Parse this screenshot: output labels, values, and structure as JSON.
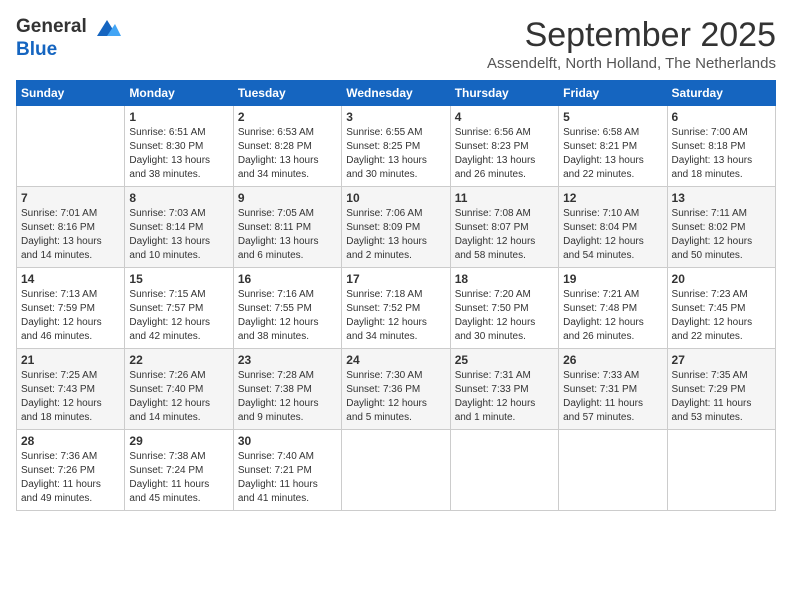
{
  "header": {
    "logo_line1": "General",
    "logo_line2": "Blue",
    "month": "September 2025",
    "location": "Assendelft, North Holland, The Netherlands"
  },
  "days_of_week": [
    "Sunday",
    "Monday",
    "Tuesday",
    "Wednesday",
    "Thursday",
    "Friday",
    "Saturday"
  ],
  "weeks": [
    [
      {
        "day": "",
        "info": ""
      },
      {
        "day": "1",
        "info": "Sunrise: 6:51 AM\nSunset: 8:30 PM\nDaylight: 13 hours\nand 38 minutes."
      },
      {
        "day": "2",
        "info": "Sunrise: 6:53 AM\nSunset: 8:28 PM\nDaylight: 13 hours\nand 34 minutes."
      },
      {
        "day": "3",
        "info": "Sunrise: 6:55 AM\nSunset: 8:25 PM\nDaylight: 13 hours\nand 30 minutes."
      },
      {
        "day": "4",
        "info": "Sunrise: 6:56 AM\nSunset: 8:23 PM\nDaylight: 13 hours\nand 26 minutes."
      },
      {
        "day": "5",
        "info": "Sunrise: 6:58 AM\nSunset: 8:21 PM\nDaylight: 13 hours\nand 22 minutes."
      },
      {
        "day": "6",
        "info": "Sunrise: 7:00 AM\nSunset: 8:18 PM\nDaylight: 13 hours\nand 18 minutes."
      }
    ],
    [
      {
        "day": "7",
        "info": "Sunrise: 7:01 AM\nSunset: 8:16 PM\nDaylight: 13 hours\nand 14 minutes."
      },
      {
        "day": "8",
        "info": "Sunrise: 7:03 AM\nSunset: 8:14 PM\nDaylight: 13 hours\nand 10 minutes."
      },
      {
        "day": "9",
        "info": "Sunrise: 7:05 AM\nSunset: 8:11 PM\nDaylight: 13 hours\nand 6 minutes."
      },
      {
        "day": "10",
        "info": "Sunrise: 7:06 AM\nSunset: 8:09 PM\nDaylight: 13 hours\nand 2 minutes."
      },
      {
        "day": "11",
        "info": "Sunrise: 7:08 AM\nSunset: 8:07 PM\nDaylight: 12 hours\nand 58 minutes."
      },
      {
        "day": "12",
        "info": "Sunrise: 7:10 AM\nSunset: 8:04 PM\nDaylight: 12 hours\nand 54 minutes."
      },
      {
        "day": "13",
        "info": "Sunrise: 7:11 AM\nSunset: 8:02 PM\nDaylight: 12 hours\nand 50 minutes."
      }
    ],
    [
      {
        "day": "14",
        "info": "Sunrise: 7:13 AM\nSunset: 7:59 PM\nDaylight: 12 hours\nand 46 minutes."
      },
      {
        "day": "15",
        "info": "Sunrise: 7:15 AM\nSunset: 7:57 PM\nDaylight: 12 hours\nand 42 minutes."
      },
      {
        "day": "16",
        "info": "Sunrise: 7:16 AM\nSunset: 7:55 PM\nDaylight: 12 hours\nand 38 minutes."
      },
      {
        "day": "17",
        "info": "Sunrise: 7:18 AM\nSunset: 7:52 PM\nDaylight: 12 hours\nand 34 minutes."
      },
      {
        "day": "18",
        "info": "Sunrise: 7:20 AM\nSunset: 7:50 PM\nDaylight: 12 hours\nand 30 minutes."
      },
      {
        "day": "19",
        "info": "Sunrise: 7:21 AM\nSunset: 7:48 PM\nDaylight: 12 hours\nand 26 minutes."
      },
      {
        "day": "20",
        "info": "Sunrise: 7:23 AM\nSunset: 7:45 PM\nDaylight: 12 hours\nand 22 minutes."
      }
    ],
    [
      {
        "day": "21",
        "info": "Sunrise: 7:25 AM\nSunset: 7:43 PM\nDaylight: 12 hours\nand 18 minutes."
      },
      {
        "day": "22",
        "info": "Sunrise: 7:26 AM\nSunset: 7:40 PM\nDaylight: 12 hours\nand 14 minutes."
      },
      {
        "day": "23",
        "info": "Sunrise: 7:28 AM\nSunset: 7:38 PM\nDaylight: 12 hours\nand 9 minutes."
      },
      {
        "day": "24",
        "info": "Sunrise: 7:30 AM\nSunset: 7:36 PM\nDaylight: 12 hours\nand 5 minutes."
      },
      {
        "day": "25",
        "info": "Sunrise: 7:31 AM\nSunset: 7:33 PM\nDaylight: 12 hours\nand 1 minute."
      },
      {
        "day": "26",
        "info": "Sunrise: 7:33 AM\nSunset: 7:31 PM\nDaylight: 11 hours\nand 57 minutes."
      },
      {
        "day": "27",
        "info": "Sunrise: 7:35 AM\nSunset: 7:29 PM\nDaylight: 11 hours\nand 53 minutes."
      }
    ],
    [
      {
        "day": "28",
        "info": "Sunrise: 7:36 AM\nSunset: 7:26 PM\nDaylight: 11 hours\nand 49 minutes."
      },
      {
        "day": "29",
        "info": "Sunrise: 7:38 AM\nSunset: 7:24 PM\nDaylight: 11 hours\nand 45 minutes."
      },
      {
        "day": "30",
        "info": "Sunrise: 7:40 AM\nSunset: 7:21 PM\nDaylight: 11 hours\nand 41 minutes."
      },
      {
        "day": "",
        "info": ""
      },
      {
        "day": "",
        "info": ""
      },
      {
        "day": "",
        "info": ""
      },
      {
        "day": "",
        "info": ""
      }
    ]
  ]
}
